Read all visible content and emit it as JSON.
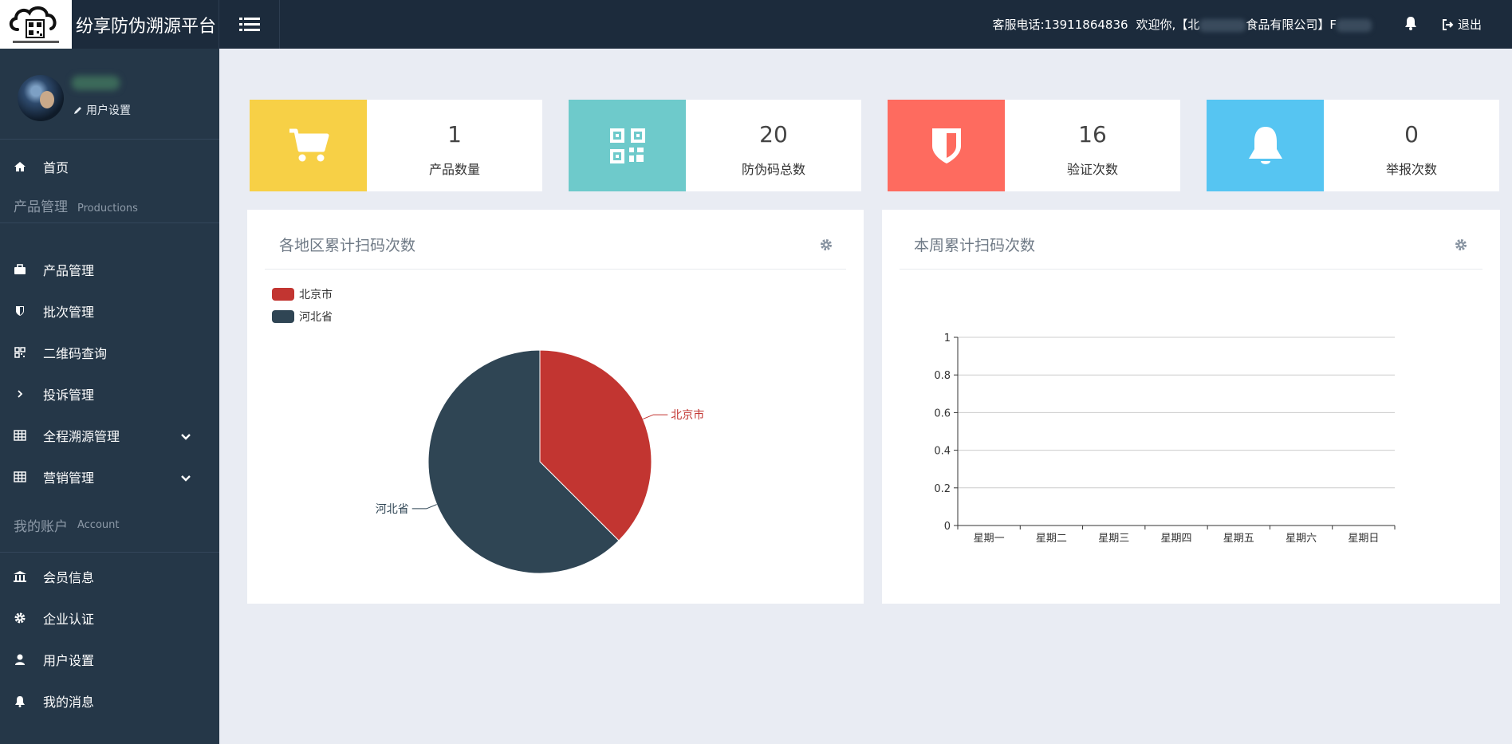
{
  "header": {
    "app_title": "纷享防伪溯源平台",
    "phone": "客服电话:13911864836",
    "welcome_prefix": "欢迎你,【北",
    "welcome_mid": "食品有限公司】",
    "welcome_suffix": "F",
    "logout": "退出"
  },
  "sidebar": {
    "user_settings": "用户设置",
    "items_top": [
      {
        "label": "首页",
        "icon": "home-icon"
      }
    ],
    "section_products": {
      "cn": "产品管理",
      "en": "Productions"
    },
    "items_products": [
      {
        "label": "产品管理",
        "icon": "briefcase-icon"
      },
      {
        "label": "批次管理",
        "icon": "shield-icon"
      },
      {
        "label": "二维码查询",
        "icon": "qrcode-icon"
      },
      {
        "label": "投诉管理",
        "icon": "chevron-right-icon"
      },
      {
        "label": "全程溯源管理",
        "icon": "table-icon"
      },
      {
        "label": "营销管理",
        "icon": "table-icon"
      }
    ],
    "section_account": {
      "cn": "我的账户",
      "en": "Account"
    },
    "items_account": [
      {
        "label": "会员信息",
        "icon": "bank-icon"
      },
      {
        "label": "企业认证",
        "icon": "gear-icon"
      },
      {
        "label": "用户设置",
        "icon": "user-icon"
      },
      {
        "label": "我的消息",
        "icon": "bell-icon"
      }
    ]
  },
  "stats": [
    {
      "value": "1",
      "label": "产品数量",
      "color": "#f7d046",
      "icon": "cart-icon"
    },
    {
      "value": "20",
      "label": "防伪码总数",
      "color": "#6ecacb",
      "icon": "qrcode-icon"
    },
    {
      "value": "16",
      "label": "验证次数",
      "color": "#fe6b5f",
      "icon": "shield-icon"
    },
    {
      "value": "0",
      "label": "举报次数",
      "color": "#56c5f2",
      "icon": "bell-icon"
    }
  ],
  "panels": {
    "region": {
      "title": "各地区累计扫码次数"
    },
    "week": {
      "title": "本周累计扫码次数"
    }
  },
  "chart_data": [
    {
      "type": "pie",
      "title": "各地区累计扫码次数",
      "categories": [
        "北京市",
        "河北省"
      ],
      "values": [
        37.5,
        62.5
      ],
      "colors": [
        "#c23531",
        "#2f4554"
      ],
      "legend": "top-left"
    },
    {
      "type": "line",
      "title": "本周累计扫码次数",
      "categories": [
        "星期一",
        "星期二",
        "星期三",
        "星期四",
        "星期五",
        "星期六",
        "星期日"
      ],
      "series": [],
      "ylim": [
        0,
        1
      ],
      "yticks": [
        "0",
        "0.2",
        "0.4",
        "0.6",
        "0.8",
        "1"
      ],
      "grid": true
    }
  ]
}
